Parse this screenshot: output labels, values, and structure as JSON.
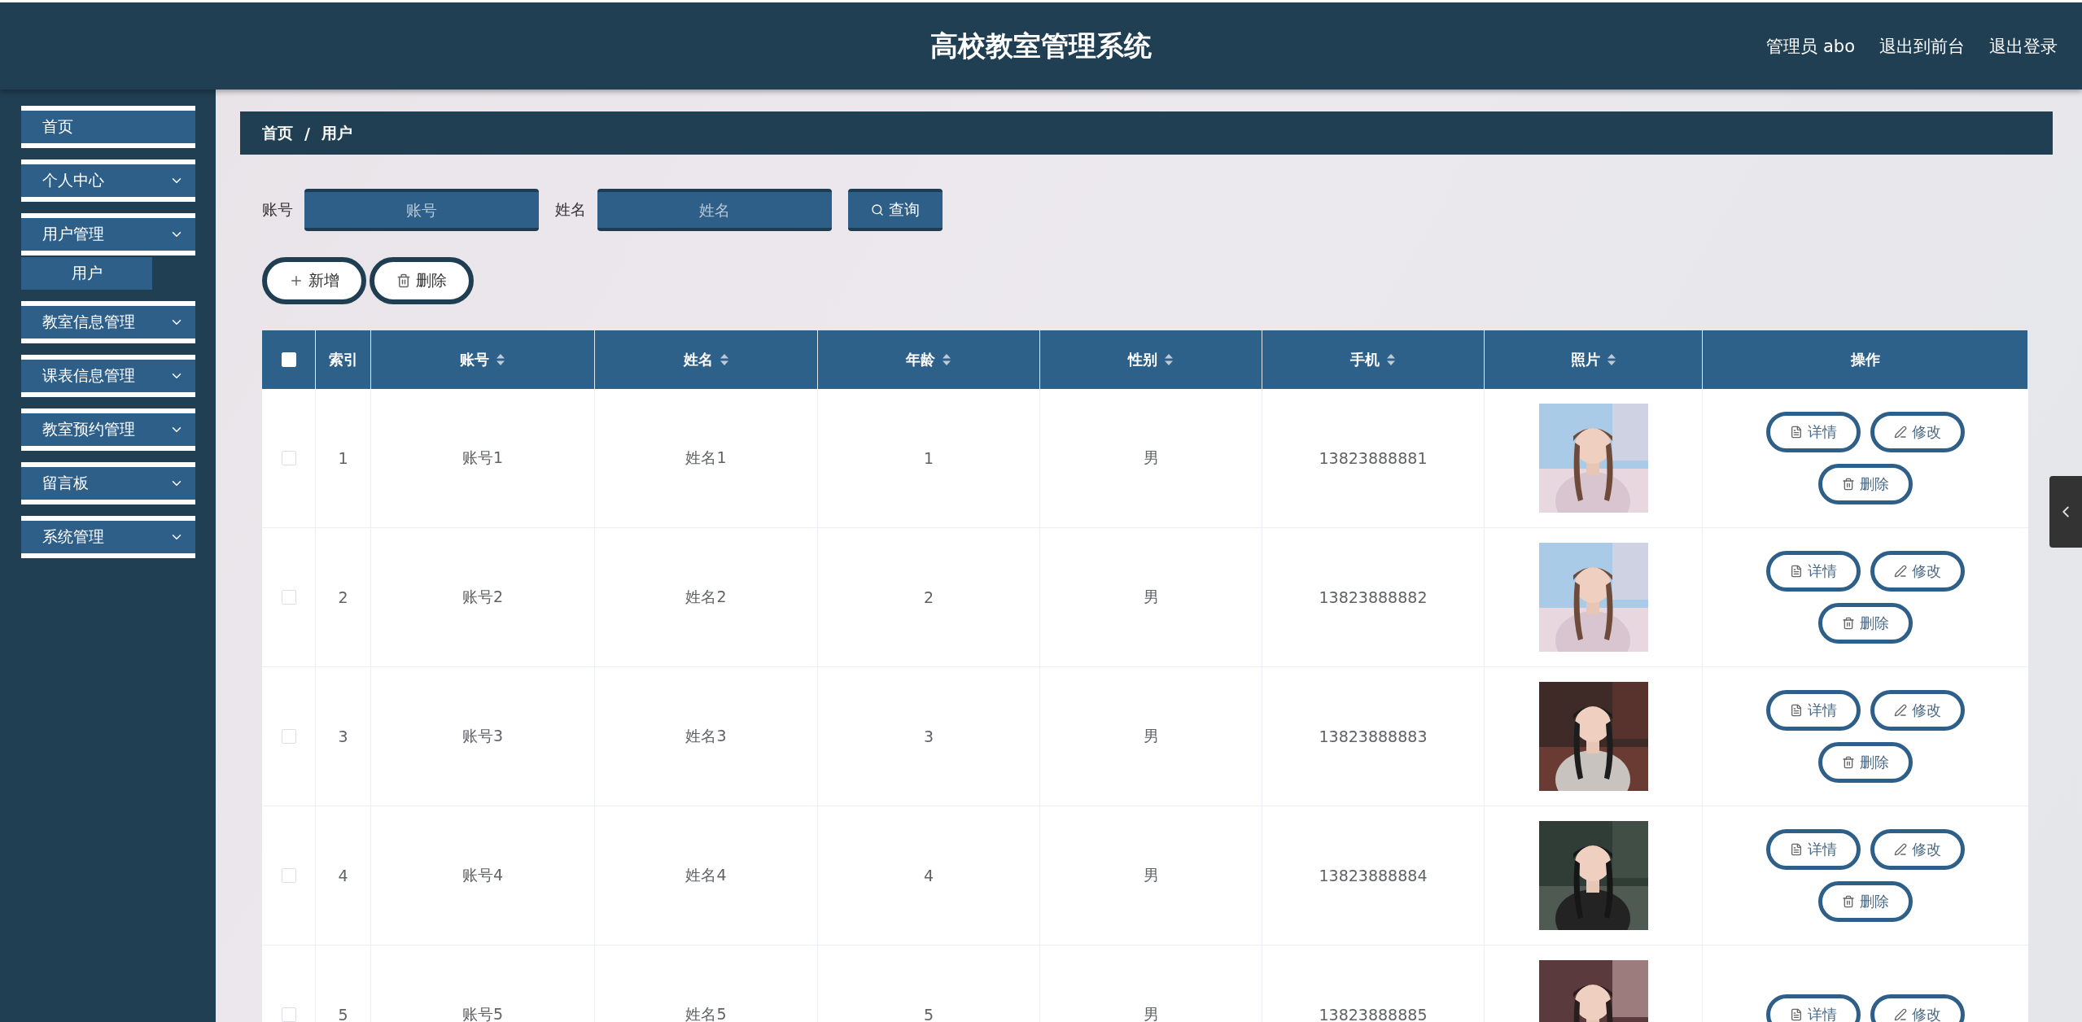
{
  "header": {
    "title": "高校教室管理系统",
    "links": [
      "管理员 abo",
      "退出到前台",
      "退出登录"
    ]
  },
  "sidebar": {
    "items": [
      {
        "label": "首页",
        "expandable": false
      },
      {
        "label": "个人中心",
        "expandable": true
      },
      {
        "label": "用户管理",
        "expandable": true,
        "children": [
          {
            "label": "用户",
            "selected": true
          }
        ]
      },
      {
        "label": "教室信息管理",
        "expandable": true
      },
      {
        "label": "课表信息管理",
        "expandable": true
      },
      {
        "label": "教室预约管理",
        "expandable": true
      },
      {
        "label": "留言板",
        "expandable": true
      },
      {
        "label": "系统管理",
        "expandable": true
      }
    ]
  },
  "breadcrumb": {
    "items": [
      "首页",
      "用户"
    ],
    "separator": "/"
  },
  "search": {
    "fields": [
      {
        "label": "账号",
        "placeholder": "账号"
      },
      {
        "label": "姓名",
        "placeholder": "姓名"
      }
    ],
    "button": "查询"
  },
  "toolbar": [
    {
      "label": "新增",
      "kind": "add"
    },
    {
      "label": "删除",
      "kind": "delete"
    }
  ],
  "table": {
    "header_checked": false,
    "columns": [
      {
        "label": "索引",
        "sortable": false
      },
      {
        "label": "账号",
        "sortable": true
      },
      {
        "label": "姓名",
        "sortable": true
      },
      {
        "label": "年龄",
        "sortable": true
      },
      {
        "label": "性别",
        "sortable": true
      },
      {
        "label": "手机",
        "sortable": true
      },
      {
        "label": "照片",
        "sortable": true
      },
      {
        "label": "操作",
        "sortable": false
      }
    ],
    "rows": [
      {
        "checked": false,
        "cells": [
          "1",
          "账号1",
          "姓名1",
          "1",
          "男",
          "13823888881"
        ],
        "photo": {
          "kind": "picture"
        },
        "actions": [
          {
            "label": "详情",
            "kind": "detail"
          },
          {
            "label": "修改",
            "kind": "edit"
          },
          {
            "label": "删除",
            "kind": "delete"
          }
        ]
      },
      {
        "checked": false,
        "cells": [
          "2",
          "账号2",
          "姓名2",
          "2",
          "男",
          "13823888882"
        ],
        "photo": {
          "kind": "picture"
        },
        "actions": [
          {
            "label": "详情",
            "kind": "detail"
          },
          {
            "label": "修改",
            "kind": "edit"
          },
          {
            "label": "删除",
            "kind": "delete"
          }
        ]
      },
      {
        "checked": false,
        "cells": [
          "3",
          "账号3",
          "姓名3",
          "3",
          "男",
          "13823888883"
        ],
        "photo": {
          "kind": "picture"
        },
        "actions": [
          {
            "label": "详情",
            "kind": "detail"
          },
          {
            "label": "修改",
            "kind": "edit"
          },
          {
            "label": "删除",
            "kind": "delete"
          }
        ]
      },
      {
        "checked": false,
        "cells": [
          "4",
          "账号4",
          "姓名4",
          "4",
          "男",
          "13823888884"
        ],
        "photo": {
          "kind": "picture"
        },
        "actions": [
          {
            "label": "详情",
            "kind": "detail"
          },
          {
            "label": "修改",
            "kind": "edit"
          },
          {
            "label": "删除",
            "kind": "delete"
          }
        ]
      },
      {
        "checked": false,
        "cells": [
          "5",
          "账号5",
          "姓名5",
          "5",
          "男",
          "13823888885"
        ],
        "photo": {
          "kind": "picture"
        },
        "actions": [
          {
            "label": "详情",
            "kind": "detail"
          },
          {
            "label": "修改",
            "kind": "edit"
          }
        ]
      }
    ]
  }
}
